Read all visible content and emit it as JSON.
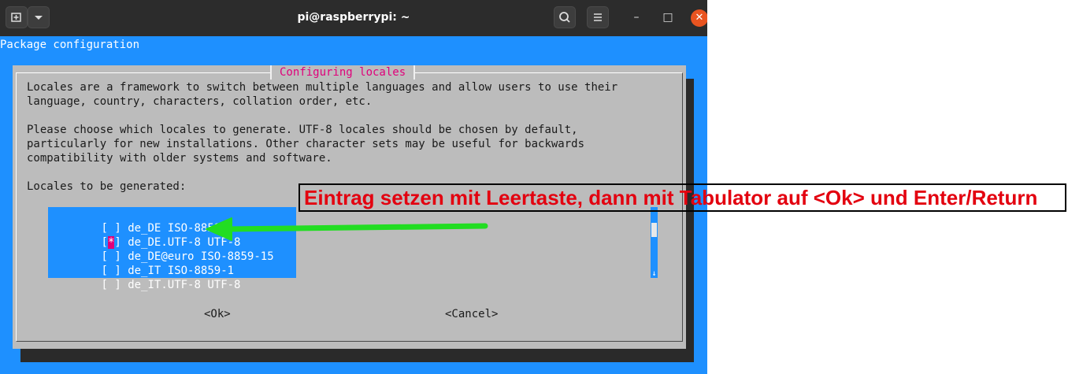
{
  "window": {
    "title": "pi@raspberrypi: ~",
    "controls": {
      "minimize": "–",
      "maximize": "□",
      "close": "✕"
    }
  },
  "terminal": {
    "header": "Package configuration"
  },
  "dialog": {
    "title": "Configuring locales",
    "paragraph1": [
      "Locales are a framework to switch between multiple languages and allow users to use their",
      "language, country, characters, collation order, etc."
    ],
    "paragraph2": [
      "Please choose which locales to generate. UTF-8 locales should be chosen by default,",
      "particularly for new installations. Other character sets may be useful for backwards",
      "compatibility with older systems and software."
    ],
    "list_label": "Locales to be generated:",
    "locales": [
      {
        "checked": false,
        "name": "de_DE ISO-8859-1"
      },
      {
        "checked": true,
        "name": "de_DE.UTF-8 UTF-8"
      },
      {
        "checked": false,
        "name": "de_DE@euro ISO-8859-15"
      },
      {
        "checked": false,
        "name": "de_IT ISO-8859-1"
      },
      {
        "checked": false,
        "name": "de_IT.UTF-8 UTF-8"
      }
    ],
    "ok_label": "<Ok>",
    "cancel_label": "<Cancel>"
  },
  "annotation": {
    "text": "Eintrag setzen mit Leertaste, dann mit Tabulator auf <Ok> und Enter/Return",
    "color": "#e3000f",
    "arrow_color": "#22dd22"
  },
  "colors": {
    "terminal_bg": "#1e90ff",
    "dialog_bg": "#bcbcbc",
    "title_accent": "#e0007a",
    "close_button": "#e95420"
  }
}
